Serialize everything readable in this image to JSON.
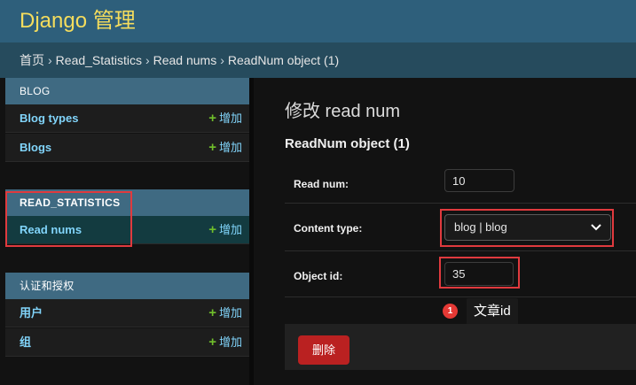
{
  "header": {
    "brand": "Django 管理"
  },
  "breadcrumbs": {
    "home": "首页",
    "app": "Read_Statistics",
    "model": "Read nums",
    "current": "ReadNum object (1)",
    "separator": "›"
  },
  "sidebar": {
    "modules": [
      {
        "caption": "BLOG",
        "rows": [
          {
            "label": "Blog types",
            "add": "增加"
          },
          {
            "label": "Blogs",
            "add": "增加"
          }
        ]
      },
      {
        "caption": "READ_STATISTICS",
        "rows": [
          {
            "label": "Read nums",
            "add": "增加"
          }
        ]
      },
      {
        "caption": "认证和授权",
        "rows": [
          {
            "label": "用户",
            "add": "增加"
          },
          {
            "label": "组",
            "add": "增加"
          }
        ]
      }
    ],
    "plus_glyph": "+"
  },
  "main": {
    "title": "修改 read num",
    "fieldset_title": "ReadNum object (1)",
    "fields": {
      "read_num": {
        "label": "Read num:",
        "value": "10"
      },
      "content_type": {
        "label": "Content type:",
        "value": "blog | blog"
      },
      "object_id": {
        "label": "Object id:",
        "value": "35"
      }
    },
    "annotation": {
      "badge": "1",
      "text": "文章id"
    },
    "delete_label": "删除"
  },
  "colors": {
    "header_bg": "#2e5f7b",
    "brand": "#f5dd5d",
    "link": "#81d4fa",
    "add_plus": "#70bf2b",
    "highlight_box": "#e03a3e",
    "delete": "#ba2121"
  },
  "icons": {
    "select_arrow": "chevron-down-icon",
    "add": "plus-icon"
  }
}
